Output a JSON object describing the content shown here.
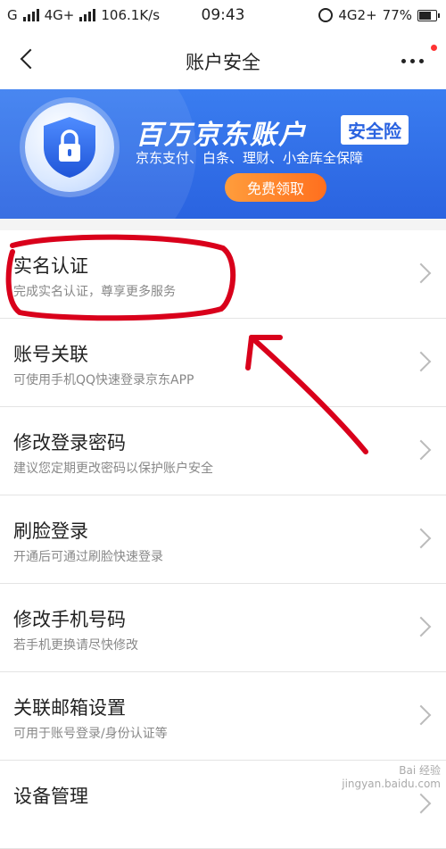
{
  "status_bar": {
    "carrier": "G",
    "network": "4G+",
    "speed": "106.1K/s",
    "time": "09:43",
    "network_right": "4G2+",
    "battery": "77%",
    "battery_level": 0.77
  },
  "nav": {
    "title": "账户安全",
    "more_badge_color": "#ff3333"
  },
  "banner": {
    "title": "百万京东账户",
    "tag": "安全险",
    "subtitle": "京东支付、白条、理财、小金库全保障",
    "cta": "免费领取",
    "accent": "#2a63e0",
    "cta_color": "#ff7a24"
  },
  "items": [
    {
      "name": "实名认证",
      "desc": "完成实名认证，尊享更多服务"
    },
    {
      "name": "账号关联",
      "desc": "可使用手机QQ快速登录京东APP"
    },
    {
      "name": "修改登录密码",
      "desc": "建议您定期更改密码以保护账户安全"
    },
    {
      "name": "刷脸登录",
      "desc": "开通后可通过刷脸快速登录"
    },
    {
      "name": "修改手机号码",
      "desc": "若手机更换请尽快修改"
    },
    {
      "name": "关联邮箱设置",
      "desc": "可用于账号登录/身份认证等"
    },
    {
      "name": "设备管理",
      "desc": ""
    }
  ],
  "watermark": {
    "line1": "Bai 经验",
    "line2": "jingyan.baidu.com"
  },
  "annotation_color": "#d9001b"
}
